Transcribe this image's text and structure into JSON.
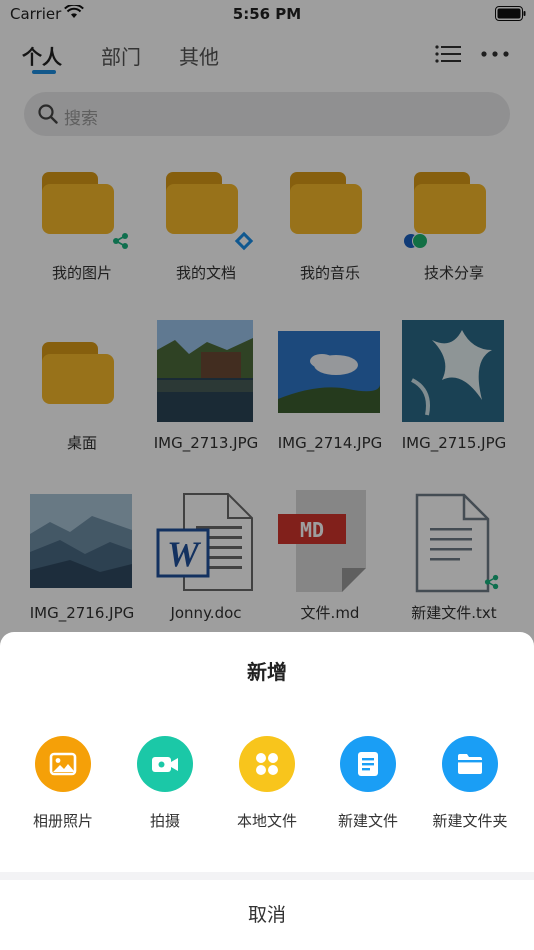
{
  "status_bar": {
    "carrier": "Carrier",
    "time": "5:56 PM"
  },
  "tabs": [
    {
      "label": "个人",
      "active": true
    },
    {
      "label": "部门",
      "active": false
    },
    {
      "label": "其他",
      "active": false
    }
  ],
  "toolbar": {
    "list_icon": "list-icon",
    "more_icon": "more-icon"
  },
  "search": {
    "placeholder": "搜索"
  },
  "files": [
    {
      "name": "我的图片",
      "kind": "folder",
      "badge": "share-icon"
    },
    {
      "name": "我的文档",
      "kind": "folder",
      "badge": "link-icon"
    },
    {
      "name": "我的音乐",
      "kind": "folder"
    },
    {
      "name": "技术分享",
      "kind": "folder",
      "badge": "avatar-group-icon"
    },
    {
      "name": "桌面",
      "kind": "folder"
    },
    {
      "name": "IMG_2713.JPG",
      "kind": "image"
    },
    {
      "name": "IMG_2714.JPG",
      "kind": "image"
    },
    {
      "name": "IMG_2715.JPG",
      "kind": "image"
    },
    {
      "name": "IMG_2716.JPG",
      "kind": "image"
    },
    {
      "name": "Jonny.doc",
      "kind": "word"
    },
    {
      "name": "文件.md",
      "kind": "markdown",
      "badge_text": "MD"
    },
    {
      "name": "新建文件.txt",
      "kind": "text",
      "badge": "share-icon"
    }
  ],
  "sheet": {
    "title": "新增",
    "actions": [
      {
        "label": "相册照片",
        "icon": "image-icon",
        "color": "#f5a008"
      },
      {
        "label": "拍摄",
        "icon": "video-camera-icon",
        "color": "#1bc8a7"
      },
      {
        "label": "本地文件",
        "icon": "grid-icon",
        "color": "#f8c51c"
      },
      {
        "label": "新建文件",
        "icon": "document-icon",
        "color": "#1a9ef5"
      },
      {
        "label": "新建文件夹",
        "icon": "folder-icon",
        "color": "#1a9ef5"
      }
    ],
    "cancel_label": "取消"
  },
  "colors": {
    "accent": "#1e8fe0",
    "folder": "#f5b82a",
    "share_badge": "#19b37f"
  }
}
